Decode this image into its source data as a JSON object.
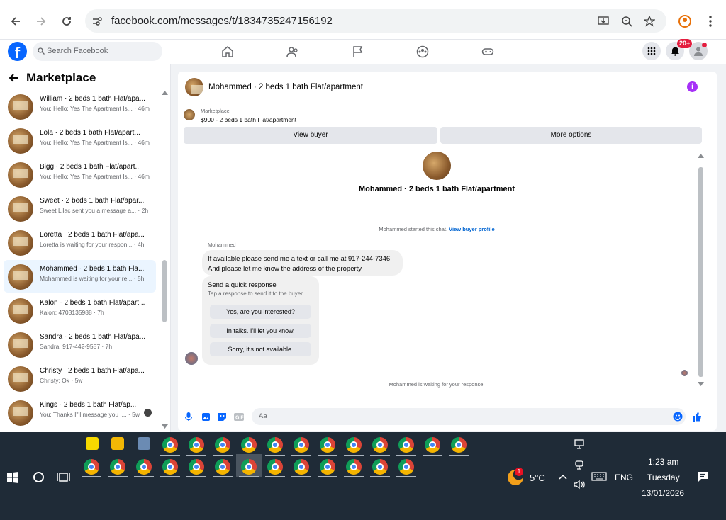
{
  "browser": {
    "url": "facebook.com/messages/t/1834735247156192"
  },
  "facebook": {
    "search_placeholder": "Search Facebook",
    "notification_badge": "20+",
    "brand_color": "#0866ff"
  },
  "sidebar": {
    "title": "Marketplace",
    "conversations": [
      {
        "name": "William · 2 beds 1 bath Flat/apa...",
        "snippet": "You: Hello: Yes The Apartment Is... · 46m",
        "active": false
      },
      {
        "name": "Lola · 2 beds 1 bath Flat/apart...",
        "snippet": "You: Hello: Yes The Apartment Is... · 46m",
        "active": false
      },
      {
        "name": "Bigg · 2 beds 1 bath Flat/apart...",
        "snippet": "You: Hello: Yes The Apartment Is... · 46m",
        "active": false
      },
      {
        "name": "Sweet · 2 beds 1 bath Flat/apar...",
        "snippet": "Sweet Lilac sent you a message a... · 2h",
        "active": false
      },
      {
        "name": "Loretta · 2 beds 1 bath Flat/apa...",
        "snippet": "Loretta is waiting for your respon... · 4h",
        "active": false
      },
      {
        "name": "Mohammed · 2 beds 1 bath Fla...",
        "snippet": "Mohammed is waiting for your re... · 5h",
        "active": true
      },
      {
        "name": "Kalon · 2 beds 1 bath Flat/apart...",
        "snippet": "Kalon: 4703135988 · 7h",
        "active": false
      },
      {
        "name": "Sandra · 2 beds 1 bath Flat/apa...",
        "snippet": "Sandra: 917-442-9557 · 7h",
        "active": false
      },
      {
        "name": "Christy · 2 beds 1 bath Flat/apa...",
        "snippet": "Christy: Ok · 5w",
        "active": false
      },
      {
        "name": "Kings · 2 beds 1 bath Flat/ap...",
        "snippet": "You: Thanks I\"ll message you i... · 5w",
        "active": false
      }
    ]
  },
  "chat": {
    "header_title": "Mohammed · 2 beds 1 bath Flat/apartment",
    "marketplace_label": "Marketplace",
    "listing": "$900 - 2 beds 1 bath Flat/apartment",
    "view_buyer": "View buyer",
    "more_options": "More options",
    "profile_name": "Mohammed · 2 beds 1 bath Flat/apartment",
    "started_text": "Mohammed started this chat.",
    "view_profile_link": "View buyer profile",
    "sender_name": "Mohammed",
    "message_line1": "If available please send me a text or call me at 917-244-7346",
    "message_line2": "And please let me know the address of the property",
    "quick_title": "Send a quick response",
    "quick_subtitle": "Tap a response to send it to the buyer.",
    "quick_replies": [
      "Yes, are you interested?",
      "In talks. I'll let you know.",
      "Sorry, it's not available."
    ],
    "waiting_text": "Mohammed is waiting for your response.",
    "composer_placeholder": "Aa"
  },
  "taskbar": {
    "weather_temp": "5°C",
    "weather_badge": "1",
    "language": "ENG",
    "time": "1:23 am",
    "day": "Tuesday",
    "date": "13/01/2026"
  }
}
